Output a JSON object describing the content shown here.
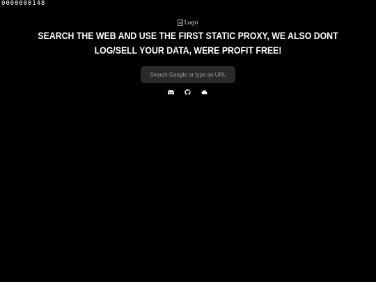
{
  "visit_counter": {
    "value": "0000000148"
  },
  "logo": {
    "alt_text": "Logo"
  },
  "headline": {
    "text": "SEARCH THE WEB AND USE THE FIRST STATIC PROXY, WE ALSO DONT LOG/SELL YOUR DATA, WERE PROFIT FREE!"
  },
  "search": {
    "placeholder": "Search Google or type an URL",
    "value": ""
  },
  "social_links": [
    {
      "icon": "discord-icon"
    },
    {
      "icon": "github-icon"
    },
    {
      "icon": "cloud-icon"
    }
  ],
  "colors": {
    "background": "#000000",
    "text": "#ffffff",
    "search_bg": "#2a2a2a",
    "placeholder": "#9d9d9d"
  }
}
